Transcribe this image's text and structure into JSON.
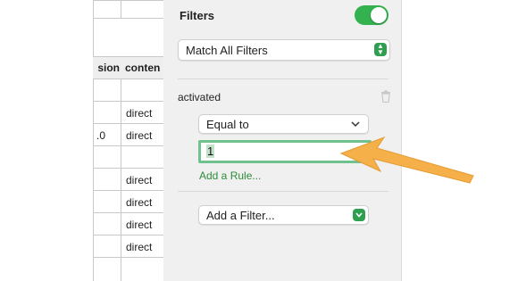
{
  "sheet": {
    "headers": [
      "sion",
      "conten"
    ],
    "rows": [
      {
        "version": "",
        "content": ""
      },
      {
        "version": "",
        "content": "direct"
      },
      {
        "version": ".0",
        "content": "direct"
      },
      {
        "version": "",
        "content": ""
      },
      {
        "version": "",
        "content": "direct"
      },
      {
        "version": "",
        "content": "direct"
      },
      {
        "version": "",
        "content": "direct"
      },
      {
        "version": "",
        "content": "direct"
      },
      {
        "version": "",
        "content": ""
      }
    ]
  },
  "panel": {
    "title": "Filters",
    "toggle_on": true,
    "match_select": "Match All Filters",
    "filter": {
      "column": "activated",
      "operator": "Equal to",
      "value": "1",
      "add_rule": "Add a Rule..."
    },
    "add_filter": "Add a Filter..."
  },
  "colors": {
    "accent_green": "#33b24f",
    "arrow": "#f5b04a"
  },
  "icons": [
    "trash-icon",
    "chevron-down-icon",
    "stepper-icon"
  ]
}
